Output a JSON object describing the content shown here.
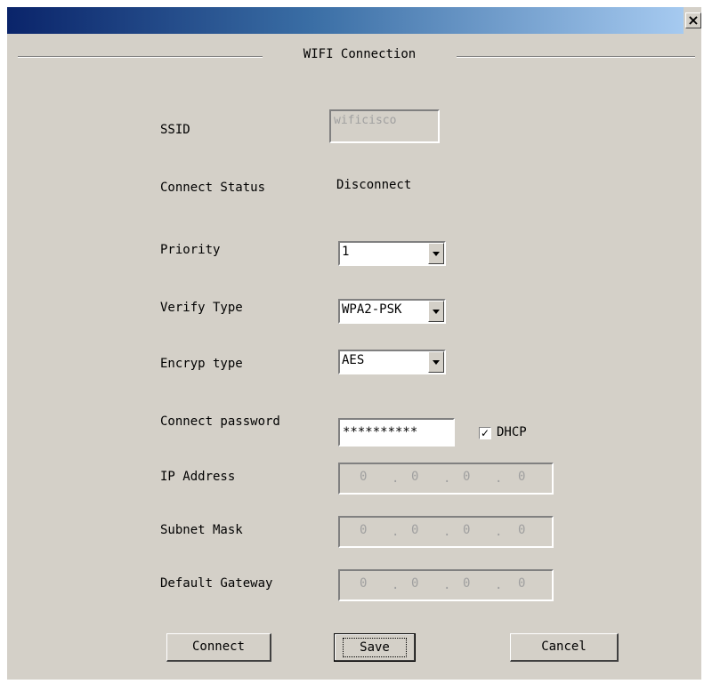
{
  "title_bar": {
    "close_glyph": "×"
  },
  "group": {
    "title": "WIFI Connection"
  },
  "fields": {
    "ssid": {
      "label": "SSID",
      "value": "wificisco"
    },
    "status": {
      "label": "Connect Status",
      "value": "Disconnect"
    },
    "priority": {
      "label": "Priority",
      "value": "1"
    },
    "verify_type": {
      "label": "Verify Type",
      "value": "WPA2-PSK"
    },
    "encryp_type": {
      "label": "Encryp type",
      "value": "AES"
    },
    "password": {
      "label": "Connect password",
      "value": "**********"
    },
    "dhcp": {
      "label": "DHCP",
      "checked": true,
      "check_glyph": "✓"
    },
    "ip_address": {
      "label": "IP Address",
      "octets": [
        "0",
        "0",
        "0",
        "0"
      ]
    },
    "subnet_mask": {
      "label": "Subnet Mask",
      "octets": [
        "0",
        "0",
        "0",
        "0"
      ]
    },
    "gateway": {
      "label": "Default Gateway",
      "octets": [
        "0",
        "0",
        "0",
        "0"
      ]
    }
  },
  "buttons": {
    "connect": "Connect",
    "save": "Save",
    "cancel": "Cancel"
  },
  "colors": {
    "dialog_bg": "#d4d0c8",
    "title_start": "#0a246a",
    "title_end": "#a6caf0"
  }
}
